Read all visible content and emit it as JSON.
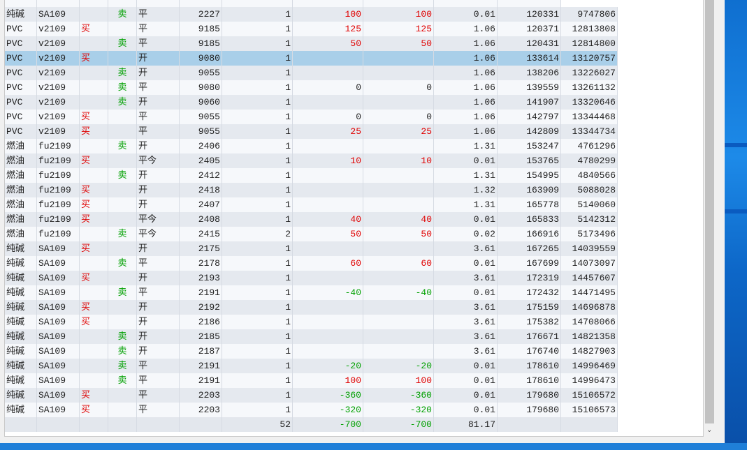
{
  "rows": [
    [
      "纯碱",
      "SA109",
      "",
      "卖",
      "平",
      "2227",
      "1",
      "100",
      "100",
      "0.01",
      "120331",
      "9747806"
    ],
    [
      "PVC",
      "v2109",
      "买",
      "",
      "平",
      "9185",
      "1",
      "125",
      "125",
      "1.06",
      "120371",
      "12813808"
    ],
    [
      "PVC",
      "v2109",
      "",
      "卖",
      "平",
      "9185",
      "1",
      "50",
      "50",
      "1.06",
      "120431",
      "12814800"
    ],
    [
      "PVC",
      "v2109",
      "买",
      "",
      "开",
      "9080",
      "1",
      "",
      "",
      "1.06",
      "133614",
      "13120757"
    ],
    [
      "PVC",
      "v2109",
      "",
      "卖",
      "开",
      "9055",
      "1",
      "",
      "",
      "1.06",
      "138206",
      "13226027"
    ],
    [
      "PVC",
      "v2109",
      "",
      "卖",
      "平",
      "9080",
      "1",
      "0",
      "0",
      "1.06",
      "139559",
      "13261132"
    ],
    [
      "PVC",
      "v2109",
      "",
      "卖",
      "开",
      "9060",
      "1",
      "",
      "",
      "1.06",
      "141907",
      "13320646"
    ],
    [
      "PVC",
      "v2109",
      "买",
      "",
      "平",
      "9055",
      "1",
      "0",
      "0",
      "1.06",
      "142797",
      "13344468"
    ],
    [
      "PVC",
      "v2109",
      "买",
      "",
      "平",
      "9055",
      "1",
      "25",
      "25",
      "1.06",
      "142809",
      "13344734"
    ],
    [
      "燃油",
      "fu2109",
      "",
      "卖",
      "开",
      "2406",
      "1",
      "",
      "",
      "1.31",
      "153247",
      "4761296"
    ],
    [
      "燃油",
      "fu2109",
      "买",
      "",
      "平今",
      "2405",
      "1",
      "10",
      "10",
      "0.01",
      "153765",
      "4780299"
    ],
    [
      "燃油",
      "fu2109",
      "",
      "卖",
      "开",
      "2412",
      "1",
      "",
      "",
      "1.31",
      "154995",
      "4840566"
    ],
    [
      "燃油",
      "fu2109",
      "买",
      "",
      "开",
      "2418",
      "1",
      "",
      "",
      "1.32",
      "163909",
      "5088028"
    ],
    [
      "燃油",
      "fu2109",
      "买",
      "",
      "开",
      "2407",
      "1",
      "",
      "",
      "1.31",
      "165778",
      "5140060"
    ],
    [
      "燃油",
      "fu2109",
      "买",
      "",
      "平今",
      "2408",
      "1",
      "40",
      "40",
      "0.01",
      "165833",
      "5142312"
    ],
    [
      "燃油",
      "fu2109",
      "",
      "卖",
      "平今",
      "2415",
      "2",
      "50",
      "50",
      "0.02",
      "166916",
      "5173496"
    ],
    [
      "纯碱",
      "SA109",
      "买",
      "",
      "开",
      "2175",
      "1",
      "",
      "",
      "3.61",
      "167265",
      "14039559"
    ],
    [
      "纯碱",
      "SA109",
      "",
      "卖",
      "平",
      "2178",
      "1",
      "60",
      "60",
      "0.01",
      "167699",
      "14073097"
    ],
    [
      "纯碱",
      "SA109",
      "买",
      "",
      "开",
      "2193",
      "1",
      "",
      "",
      "3.61",
      "172319",
      "14457607"
    ],
    [
      "纯碱",
      "SA109",
      "",
      "卖",
      "平",
      "2191",
      "1",
      "-40",
      "-40",
      "0.01",
      "172432",
      "14471495"
    ],
    [
      "纯碱",
      "SA109",
      "买",
      "",
      "开",
      "2192",
      "1",
      "",
      "",
      "3.61",
      "175159",
      "14696878"
    ],
    [
      "纯碱",
      "SA109",
      "买",
      "",
      "开",
      "2186",
      "1",
      "",
      "",
      "3.61",
      "175382",
      "14708066"
    ],
    [
      "纯碱",
      "SA109",
      "",
      "卖",
      "开",
      "2185",
      "1",
      "",
      "",
      "3.61",
      "176671",
      "14821358"
    ],
    [
      "纯碱",
      "SA109",
      "",
      "卖",
      "开",
      "2187",
      "1",
      "",
      "",
      "3.61",
      "176740",
      "14827903"
    ],
    [
      "纯碱",
      "SA109",
      "",
      "卖",
      "平",
      "2191",
      "1",
      "-20",
      "-20",
      "0.01",
      "178610",
      "14996469"
    ],
    [
      "纯碱",
      "SA109",
      "",
      "卖",
      "平",
      "2191",
      "1",
      "100",
      "100",
      "0.01",
      "178610",
      "14996473"
    ],
    [
      "纯碱",
      "SA109",
      "买",
      "",
      "平",
      "2203",
      "1",
      "-360",
      "-360",
      "0.01",
      "179680",
      "15106572"
    ],
    [
      "纯碱",
      "SA109",
      "买",
      "",
      "平",
      "2203",
      "1",
      "-320",
      "-320",
      "0.01",
      "179680",
      "15106573"
    ]
  ],
  "selected_index": 3,
  "totals": {
    "qty": "52",
    "pnl1": "-700",
    "pnl2": "-700",
    "fee": "81.17"
  },
  "colors": {
    "buy": "#e00000",
    "sell": "#00a000",
    "selected": "#a9cfe9"
  }
}
